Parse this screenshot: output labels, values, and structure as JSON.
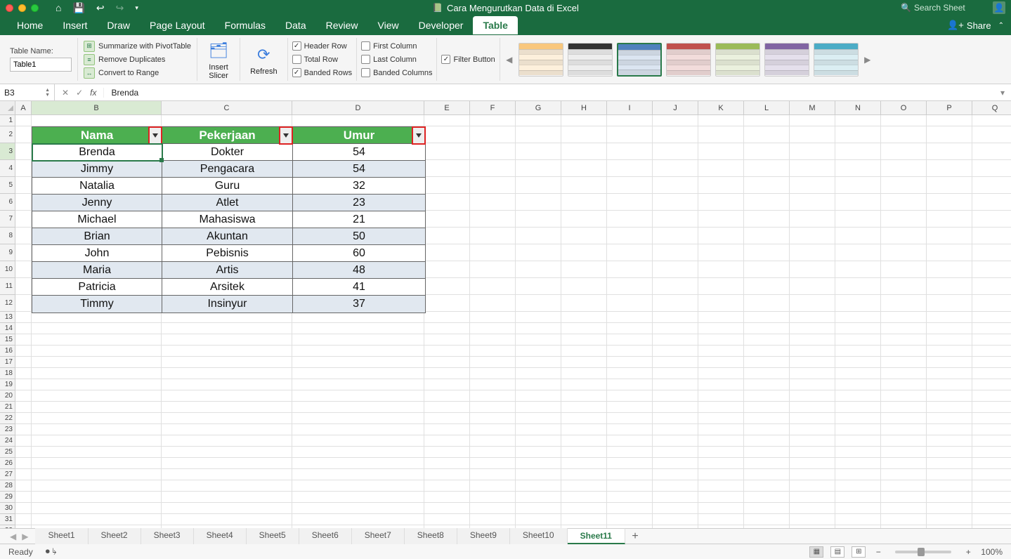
{
  "titlebar": {
    "doc_title": "Cara Mengurutkan Data di Excel",
    "search_placeholder": "Search Sheet"
  },
  "menu": {
    "tabs": [
      "Home",
      "Insert",
      "Draw",
      "Page Layout",
      "Formulas",
      "Data",
      "Review",
      "View",
      "Developer",
      "Table"
    ],
    "active": "Table",
    "share": "Share"
  },
  "ribbon": {
    "tablename_label": "Table Name:",
    "tablename_value": "Table1",
    "tools": {
      "pivot": "Summarize with PivotTable",
      "dups": "Remove Duplicates",
      "range": "Convert to Range",
      "slicer": "Insert\nSlicer",
      "refresh": "Refresh"
    },
    "options": {
      "header_row": "Header Row",
      "total_row": "Total Row",
      "banded_rows": "Banded Rows",
      "first_col": "First Column",
      "last_col": "Last Column",
      "banded_cols": "Banded Columns",
      "filter_btn": "Filter Button"
    }
  },
  "formula_bar": {
    "cell_ref": "B3",
    "value": "Brenda"
  },
  "columns": [
    "A",
    "B",
    "C",
    "D",
    "E",
    "F",
    "G",
    "H",
    "I",
    "J",
    "K",
    "L",
    "M",
    "N",
    "O",
    "P",
    "Q"
  ],
  "col_widths": {
    "A": 23,
    "B": 185,
    "C": 186,
    "D": 188,
    "other": 65
  },
  "tall_rows": [
    2,
    3,
    4,
    5,
    6,
    7,
    8,
    9,
    10,
    11,
    12
  ],
  "table": {
    "headers": [
      "Nama",
      "Pekerjaan",
      "Umur"
    ],
    "rows": [
      {
        "nama": "Brenda",
        "pekerjaan": "Dokter",
        "umur": "54"
      },
      {
        "nama": "Jimmy",
        "pekerjaan": "Pengacara",
        "umur": "54"
      },
      {
        "nama": "Natalia",
        "pekerjaan": "Guru",
        "umur": "32"
      },
      {
        "nama": "Jenny",
        "pekerjaan": "Atlet",
        "umur": "23"
      },
      {
        "nama": "Michael",
        "pekerjaan": "Mahasiswa",
        "umur": "21"
      },
      {
        "nama": "Brian",
        "pekerjaan": "Akuntan",
        "umur": "50"
      },
      {
        "nama": "John",
        "pekerjaan": "Pebisnis",
        "umur": "60"
      },
      {
        "nama": "Maria",
        "pekerjaan": "Artis",
        "umur": "48"
      },
      {
        "nama": "Patricia",
        "pekerjaan": "Arsitek",
        "umur": "41"
      },
      {
        "nama": "Timmy",
        "pekerjaan": "Insinyur",
        "umur": "37"
      }
    ]
  },
  "sheets": [
    "Sheet1",
    "Sheet2",
    "Sheet3",
    "Sheet4",
    "Sheet5",
    "Sheet6",
    "Sheet7",
    "Sheet8",
    "Sheet9",
    "Sheet10",
    "Sheet11"
  ],
  "active_sheet": "Sheet11",
  "status": {
    "ready": "Ready",
    "zoom": "100%"
  }
}
